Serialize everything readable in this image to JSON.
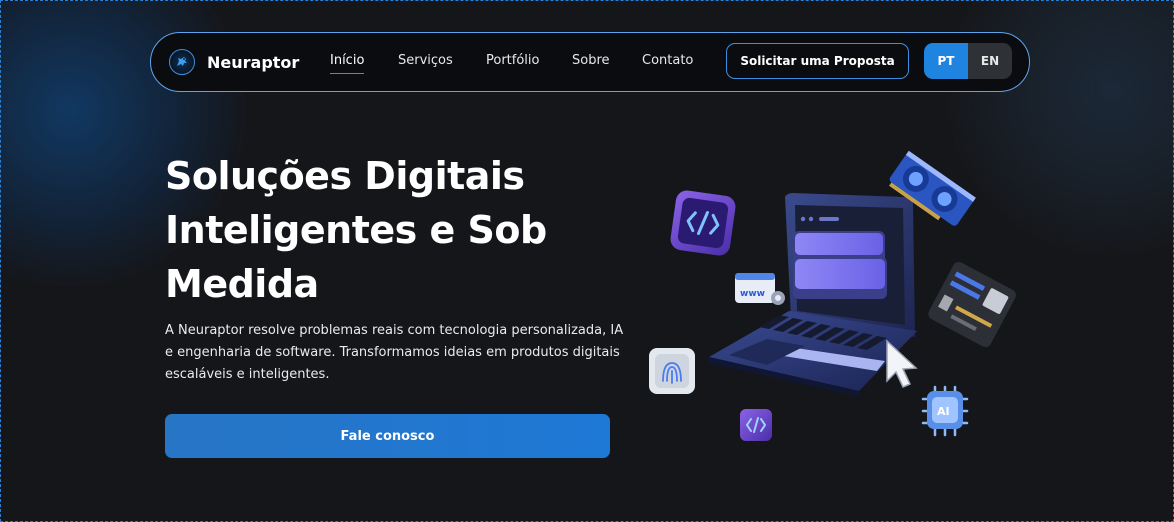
{
  "brand": {
    "name": "Neuraptor"
  },
  "nav": {
    "links": [
      {
        "label": "Início",
        "active": true
      },
      {
        "label": "Serviços",
        "active": false
      },
      {
        "label": "Portfólio",
        "active": false
      },
      {
        "label": "Sobre",
        "active": false
      },
      {
        "label": "Contato",
        "active": false
      }
    ],
    "cta_label": "Solicitar uma Proposta",
    "languages": [
      "PT",
      "EN"
    ],
    "active_language": "PT"
  },
  "hero": {
    "title": "Soluções Digitais Inteligentes e Sob Medida",
    "description": "A Neuraptor resolve problemas reais com tecnologia personalizada, IA e engenharia de software. Transformamos ideias em produtos digitais escaláveis e inteligentes.",
    "button_label": "Fale conosco"
  },
  "illustration": {
    "items": [
      "laptop",
      "code-badge-icon",
      "gpu-card-icon",
      "web-browser-icon",
      "motherboard-icon",
      "fingerprint-icon",
      "cursor-arrow-icon",
      "ai-chip-icon",
      "small-code-badge-icon"
    ],
    "chip_label": "AI",
    "browser_label": "www"
  },
  "colors": {
    "accent": "#1f84e0",
    "background": "#151619",
    "nav_border": "#5ea4ec"
  }
}
